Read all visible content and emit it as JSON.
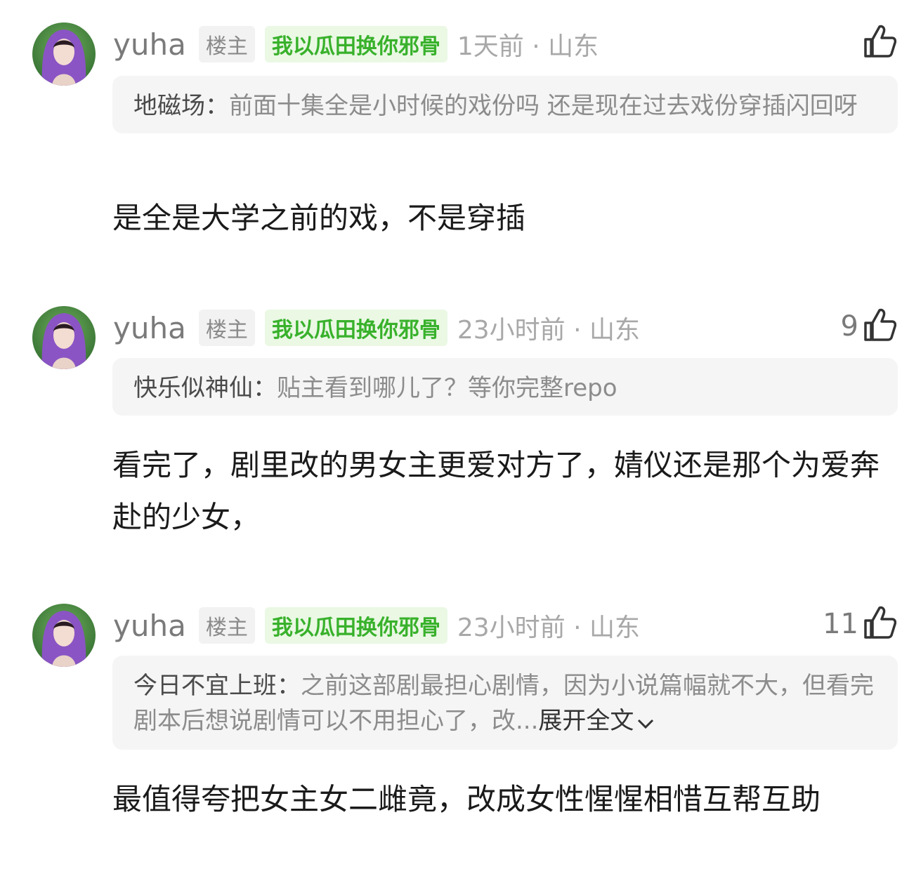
{
  "comments": [
    {
      "username": "yuha",
      "host_tag": "楼主",
      "group_tag": "我以瓜田换你邪骨",
      "meta": "1天前 · 山东",
      "likes": "",
      "quote_author": "地磁场：",
      "quote_text": "前面十集全是小时候的戏份吗 还是现在过去戏份穿插闪回呀",
      "expand_label": "",
      "reply": "是全是大学之前的戏，不是穿插"
    },
    {
      "username": "yuha",
      "host_tag": "楼主",
      "group_tag": "我以瓜田换你邪骨",
      "meta": "23小时前 · 山东",
      "likes": "9",
      "quote_author": "快乐似神仙：",
      "quote_text": "贴主看到哪儿了？等你完整repo",
      "expand_label": "",
      "reply": "看完了，剧里改的男女主更爱对方了，婧仪还是那个为爱奔赴的少女，"
    },
    {
      "username": "yuha",
      "host_tag": "楼主",
      "group_tag": "我以瓜田换你邪骨",
      "meta": "23小时前 · 山东",
      "likes": "11",
      "quote_author": "今日不宜上班：",
      "quote_text": "之前这部剧最担心剧情，因为小说篇幅就不大，但看完剧本后想说剧情可以不用担心了，改...",
      "expand_label": "展开全文",
      "reply": "最值得夸把女主女二雌竟，改成女性惺惺相惜互帮互助"
    }
  ],
  "colors": {
    "accent_green": "#38b12b",
    "tag_bg": "#eaf8e4",
    "quote_bg": "#f5f5f5"
  }
}
